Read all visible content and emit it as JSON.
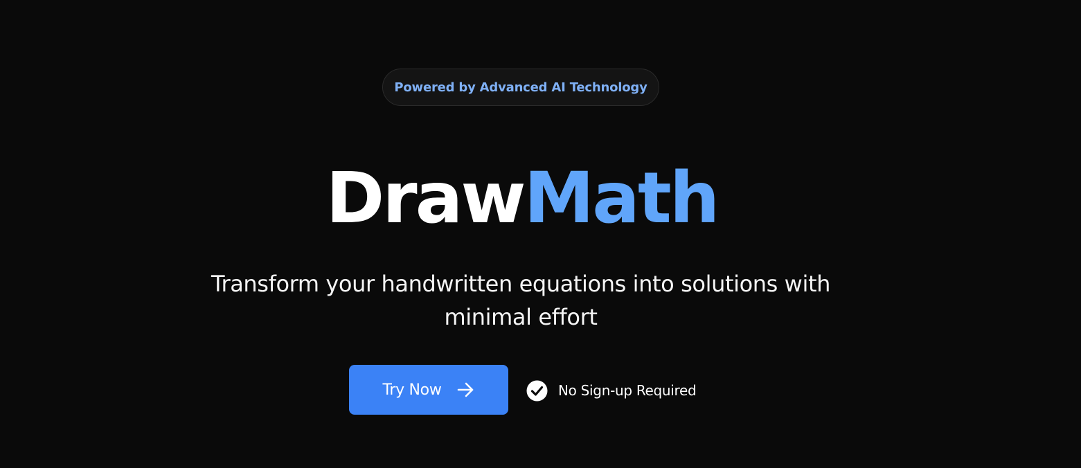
{
  "badge": {
    "text": "Powered by Advanced AI Technology",
    "text_color": "#7fb0f5"
  },
  "title": {
    "part1": "Draw",
    "part2": "Math",
    "part1_color": "#ffffff",
    "part2_color": "#60a5fa"
  },
  "subtitle": {
    "text": "Transform your handwritten equations into solutions with minimal effort"
  },
  "cta": {
    "label": "Try Now",
    "icon": "arrow-right-icon",
    "background": "#3b82f6"
  },
  "note": {
    "text": "No Sign-up Required",
    "icon": "check-circle-icon"
  },
  "background_color": "#0a0a0a"
}
